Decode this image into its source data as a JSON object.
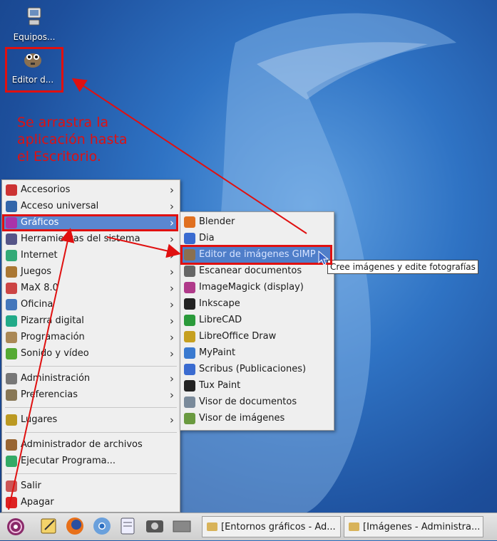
{
  "desktop": {
    "icons": [
      {
        "label": "Equipos..."
      },
      {
        "label": "Editor d..."
      }
    ],
    "annotation": "Se arrastra la\naplicación hasta\nel Escritorio."
  },
  "main_menu": {
    "groups": [
      [
        {
          "label": "Accesorios",
          "icon": "accessories-icon",
          "submenu": true
        },
        {
          "label": "Acceso universal",
          "icon": "accessibility-icon",
          "submenu": true
        },
        {
          "label": "Gráficos",
          "icon": "graphics-icon",
          "submenu": true,
          "selected": true
        },
        {
          "label": "Herramientas del sistema",
          "icon": "system-tools-icon",
          "submenu": true
        },
        {
          "label": "Internet",
          "icon": "internet-icon",
          "submenu": true
        },
        {
          "label": "Juegos",
          "icon": "games-icon",
          "submenu": true
        },
        {
          "label": "MaX 8.0",
          "icon": "max-icon",
          "submenu": true
        },
        {
          "label": "Oficina",
          "icon": "office-icon",
          "submenu": true
        },
        {
          "label": "Pizarra digital",
          "icon": "whiteboard-icon",
          "submenu": true
        },
        {
          "label": "Programación",
          "icon": "programming-icon",
          "submenu": true
        },
        {
          "label": "Sonido y vídeo",
          "icon": "multimedia-icon",
          "submenu": true
        }
      ],
      [
        {
          "label": "Administración",
          "icon": "administration-icon",
          "submenu": true
        },
        {
          "label": "Preferencias",
          "icon": "preferences-icon",
          "submenu": true
        }
      ],
      [
        {
          "label": "Lugares",
          "icon": "places-icon",
          "submenu": true
        }
      ],
      [
        {
          "label": "Administrador de archivos",
          "icon": "file-manager-icon",
          "submenu": false
        },
        {
          "label": "Ejecutar Programa...",
          "icon": "run-icon",
          "submenu": false
        }
      ],
      [
        {
          "label": "Salir",
          "icon": "logout-icon",
          "submenu": false
        },
        {
          "label": "Apagar",
          "icon": "shutdown-icon",
          "submenu": false
        }
      ]
    ]
  },
  "graphics_submenu": {
    "items": [
      {
        "label": "Blender",
        "icon": "blender-icon"
      },
      {
        "label": "Dia",
        "icon": "dia-icon"
      },
      {
        "label": "Editor de imágenes GIMP",
        "icon": "gimp-icon",
        "hovered": true
      },
      {
        "label": "Escanear documentos",
        "icon": "scanner-icon"
      },
      {
        "label": "ImageMagick (display)",
        "icon": "imagemagick-icon"
      },
      {
        "label": "Inkscape",
        "icon": "inkscape-icon"
      },
      {
        "label": "LibreCAD",
        "icon": "librecad-icon"
      },
      {
        "label": "LibreOffice Draw",
        "icon": "libreoffice-draw-icon"
      },
      {
        "label": "MyPaint",
        "icon": "mypaint-icon"
      },
      {
        "label": "Scribus (Publicaciones)",
        "icon": "scribus-icon"
      },
      {
        "label": "Tux Paint",
        "icon": "tuxpaint-icon"
      },
      {
        "label": "Visor de documentos",
        "icon": "document-viewer-icon"
      },
      {
        "label": "Visor de imágenes",
        "icon": "image-viewer-icon"
      }
    ]
  },
  "tooltip": "Cree imágenes y edite fotografías",
  "taskbar": {
    "launchers": [
      "main-menu-icon",
      "text-editor-icon",
      "firefox-icon",
      "chromium-icon",
      "notes-icon",
      "screenshot-icon",
      "show-desktop-icon"
    ],
    "tasks": [
      {
        "label": "[Entornos gráficos - Ad..."
      },
      {
        "label": "[Imágenes - Administra..."
      }
    ]
  },
  "colors": {
    "highlight_red": "#e01010",
    "selection_blue": "#5a87d0",
    "menu_bg": "#efefef"
  }
}
